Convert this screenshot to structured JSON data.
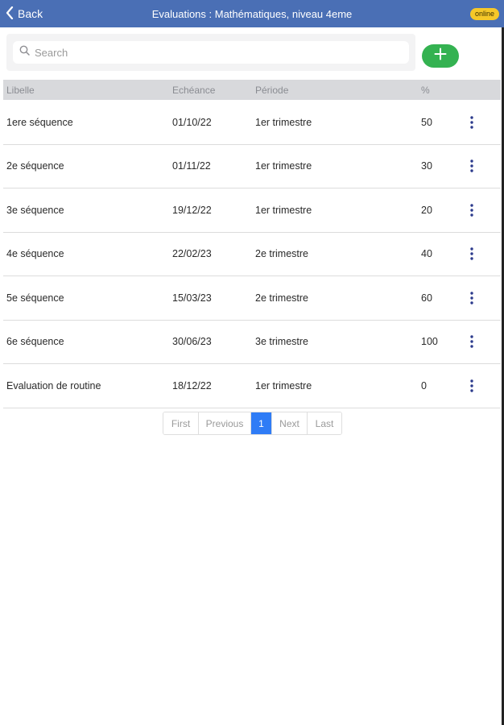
{
  "header": {
    "back_label": "Back",
    "title": "Evaluations : Mathématiques, niveau 4eme",
    "status_badge": "online"
  },
  "search": {
    "placeholder": "Search",
    "value": ""
  },
  "table": {
    "columns": [
      "Libelle",
      "Echéance",
      "Période",
      "%"
    ],
    "rows": [
      {
        "libelle": "1ere séquence",
        "echeance": "01/10/22",
        "periode": "1er trimestre",
        "pct": "50"
      },
      {
        "libelle": "2e séquence",
        "echeance": "01/11/22",
        "periode": "1er trimestre",
        "pct": "30"
      },
      {
        "libelle": "3e séquence",
        "echeance": "19/12/22",
        "periode": "1er trimestre",
        "pct": "20"
      },
      {
        "libelle": "4e séquence",
        "echeance": "22/02/23",
        "periode": "2e trimestre",
        "pct": "40"
      },
      {
        "libelle": "5e séquence",
        "echeance": "15/03/23",
        "periode": "2e trimestre",
        "pct": "60"
      },
      {
        "libelle": "6e séquence",
        "echeance": "30/06/23",
        "periode": "3e trimestre",
        "pct": "100"
      },
      {
        "libelle": "Evaluation de routine",
        "echeance": "18/12/22",
        "periode": "1er trimestre",
        "pct": "0"
      }
    ]
  },
  "pagination": {
    "first": "First",
    "previous": "Previous",
    "current": "1",
    "next": "Next",
    "last": "Last"
  },
  "icons": {
    "back": "chevron-left-icon",
    "search": "search-icon",
    "add": "plus-icon",
    "row_menu": "kebab-menu-icon"
  },
  "colors": {
    "header": "#4a6fb5",
    "badge": "#f6c829",
    "add_button": "#34b251",
    "kebab": "#2b3a8c",
    "page_active": "#2f7cf6",
    "table_header": "#d8d9dc"
  }
}
